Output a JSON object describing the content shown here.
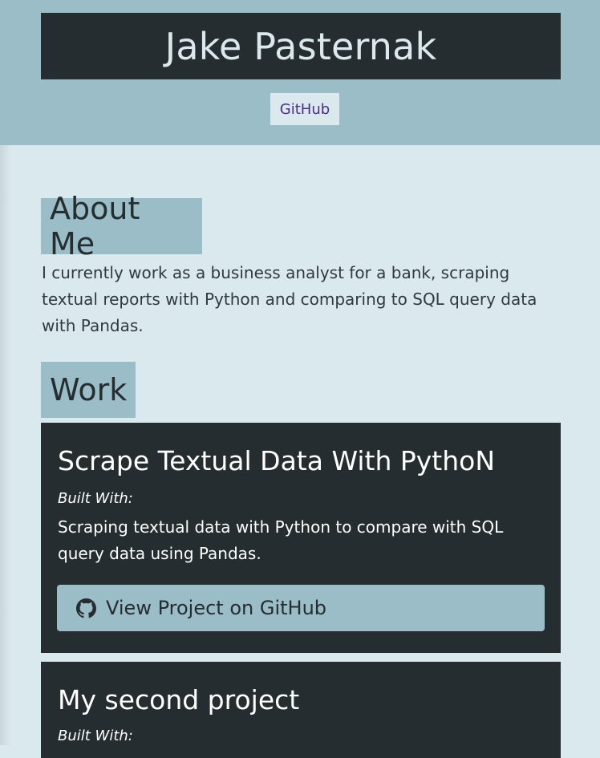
{
  "header": {
    "name": "Jake Pasternak",
    "github_link": "GitHub"
  },
  "about": {
    "heading": "About Me",
    "text": "I currently work as a business analyst for a bank, scraping textual reports with Python and comparing to SQL query data with Pandas."
  },
  "work": {
    "heading": "Work",
    "projects": [
      {
        "title": "Scrape Textual Data With PythoN",
        "built_with": "Built With:",
        "description": "Scraping textual data with Python to compare with SQL query data using Pandas.",
        "button_label": "View Project on GitHub",
        "button_icon": "github-icon"
      },
      {
        "title": "My second project",
        "built_with": "Built With:"
      }
    ]
  },
  "colors": {
    "header_bg": "#9bbdc7",
    "page_bg": "#dae9ee",
    "dark": "#252d31",
    "link": "#4a2f86"
  }
}
